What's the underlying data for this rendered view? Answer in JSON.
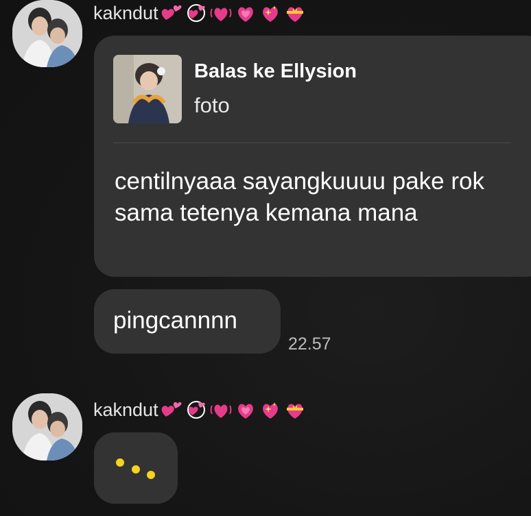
{
  "messages": [
    {
      "sender": "kakndut",
      "sender_emojis": [
        "two-hearts",
        "revolving-hearts",
        "beating-heart",
        "growing-heart",
        "sparkling-heart",
        "heart-with-ribbon"
      ],
      "reply": {
        "title": "Balas ke Ellysion",
        "subtitle": "foto"
      },
      "text": "centilnyaaa sayangkuuuu pake rok sama tetenya kemana mana"
    },
    {
      "text": "pingcannnn",
      "time": "22.57"
    }
  ],
  "typing": {
    "sender": "kakndut",
    "sender_emojis": [
      "two-hearts",
      "revolving-hearts",
      "beating-heart",
      "growing-heart",
      "sparkling-heart",
      "heart-with-ribbon"
    ],
    "indicator": "typing-dots"
  },
  "colors": {
    "bubble": "#333333",
    "background": "#161616",
    "typing_dots": "#f6d31c",
    "heart_pink": "#e63b8a"
  }
}
